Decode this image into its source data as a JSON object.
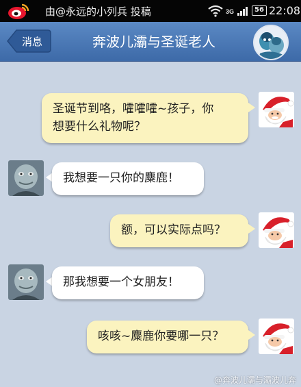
{
  "status_bar": {
    "post_info": "由@永远的小列兵 投稿",
    "network": "3G",
    "battery": "56",
    "time": "22:08"
  },
  "header": {
    "back_label": "消息",
    "title": "奔波儿灞与圣诞老人"
  },
  "messages": [
    {
      "sender": "santa",
      "side": "right",
      "lines": [
        "圣诞节到咯，嚯嚯嚯~孩子，你",
        "想要什么礼物呢？"
      ]
    },
    {
      "sender": "benboerba",
      "side": "left",
      "lines": [
        "我想要一只你的麋鹿！"
      ]
    },
    {
      "sender": "santa",
      "side": "right",
      "lines": [
        "额，可以实际点吗？"
      ]
    },
    {
      "sender": "benboerba",
      "side": "left",
      "lines": [
        "那我想要一个女朋友！"
      ]
    },
    {
      "sender": "santa",
      "side": "right",
      "lines": [
        "咳咳~麋鹿你要哪一只？"
      ]
    }
  ],
  "watermark": "@奔波儿灞与灞波儿奔",
  "colors": {
    "background": "#c9d4e3",
    "header": "#4a78b6",
    "bubble_right": "#fbf3bf",
    "bubble_left": "#ffffff"
  },
  "icons": [
    "weibo-logo-icon",
    "wifi-icon",
    "signal-icon",
    "battery-icon",
    "back-arrow-icon"
  ]
}
